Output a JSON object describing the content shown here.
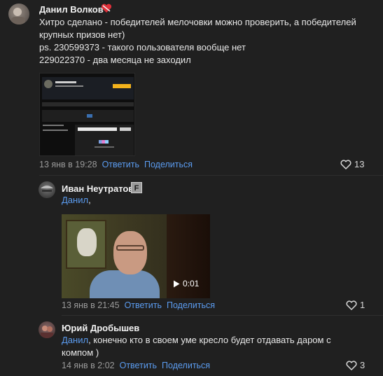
{
  "comments": [
    {
      "author": "Данил Волков",
      "badge": "heart-emoji",
      "lines": [
        "Хитро сделано - победителей мелочовки можно проверить, а победителей",
        "крупных призов нет)",
        "ps. 230599373 - такого пользователя вообще нет",
        "229022370 - два месяца не заходил"
      ],
      "timestamp": "13 янв в 19:28",
      "reply_label": "Ответить",
      "share_label": "Поделиться",
      "likes": "13"
    },
    {
      "author": "Иван Неутратов",
      "badge": "F",
      "mention": "Данил",
      "after_mention": ",",
      "video_duration": "0:01",
      "timestamp": "13 янв в 21:45",
      "reply_label": "Ответить",
      "share_label": "Поделиться",
      "likes": "1"
    },
    {
      "author": "Юрий Дробышев",
      "mention": "Данил",
      "after_mention": ", конечно кто в своем уме кресло будет отдавать даром с",
      "line2": "компом )",
      "timestamp": "14 янв в 2:02",
      "reply_label": "Ответить",
      "share_label": "Поделиться",
      "likes": "3"
    }
  ],
  "colors": {
    "background": "#202020",
    "link": "#5b9cf0",
    "meta": "#9a9a9a"
  }
}
